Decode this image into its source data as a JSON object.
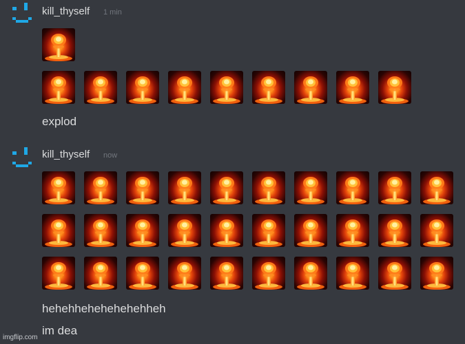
{
  "messages": [
    {
      "username": "kill_thyself",
      "timestamp": "1 min",
      "emoji_rows": [
        1,
        9
      ],
      "emoji_name": "explosion-emoji",
      "lines": [
        "explod"
      ]
    },
    {
      "username": "kill_thyself",
      "timestamp": "now",
      "emoji_rows": [
        10,
        10,
        10
      ],
      "emoji_name": "explosion-emoji",
      "lines": [
        "hehehhehehehehehheh",
        "im dea"
      ]
    }
  ],
  "avatar_icon": "pixel-smiley-icon",
  "colors": {
    "background": "#36393f",
    "text": "#dcddde",
    "muted": "#72767d",
    "avatar": "#1fa8e6"
  },
  "watermark": "imgflip.com"
}
